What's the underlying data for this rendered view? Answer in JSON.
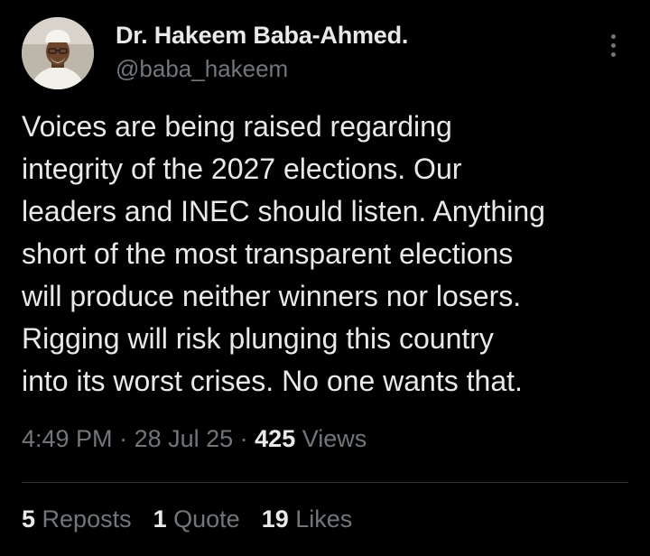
{
  "author": {
    "name": "Dr. Hakeem Baba-Ahmed.",
    "handle": "@baba_hakeem"
  },
  "post": {
    "lines": [
      "Voices are being raised regarding",
      "integrity of the 2027 elections. Our",
      "leaders and INEC should listen. Anything",
      "short of the most transparent elections",
      "will produce neither winners nor losers.",
      "Rigging will risk plunging this country",
      "into its worst crises. No one wants that."
    ]
  },
  "meta": {
    "time": "4:49 PM",
    "sep1": " · ",
    "date": "28 Jul 25",
    "sep2": " · ",
    "views_count": "425",
    "views_label": " Views"
  },
  "stats": {
    "reposts_count": "5",
    "reposts_label": " Reposts",
    "quotes_count": "1",
    "quotes_label": " Quote",
    "likes_count": "19",
    "likes_label": " Likes"
  },
  "icons": {
    "more": "more-vertical-icon"
  },
  "colors": {
    "background": "#000000",
    "primary_text": "#e7e9ea",
    "secondary_text": "#71767b",
    "divider": "#2f3336"
  }
}
